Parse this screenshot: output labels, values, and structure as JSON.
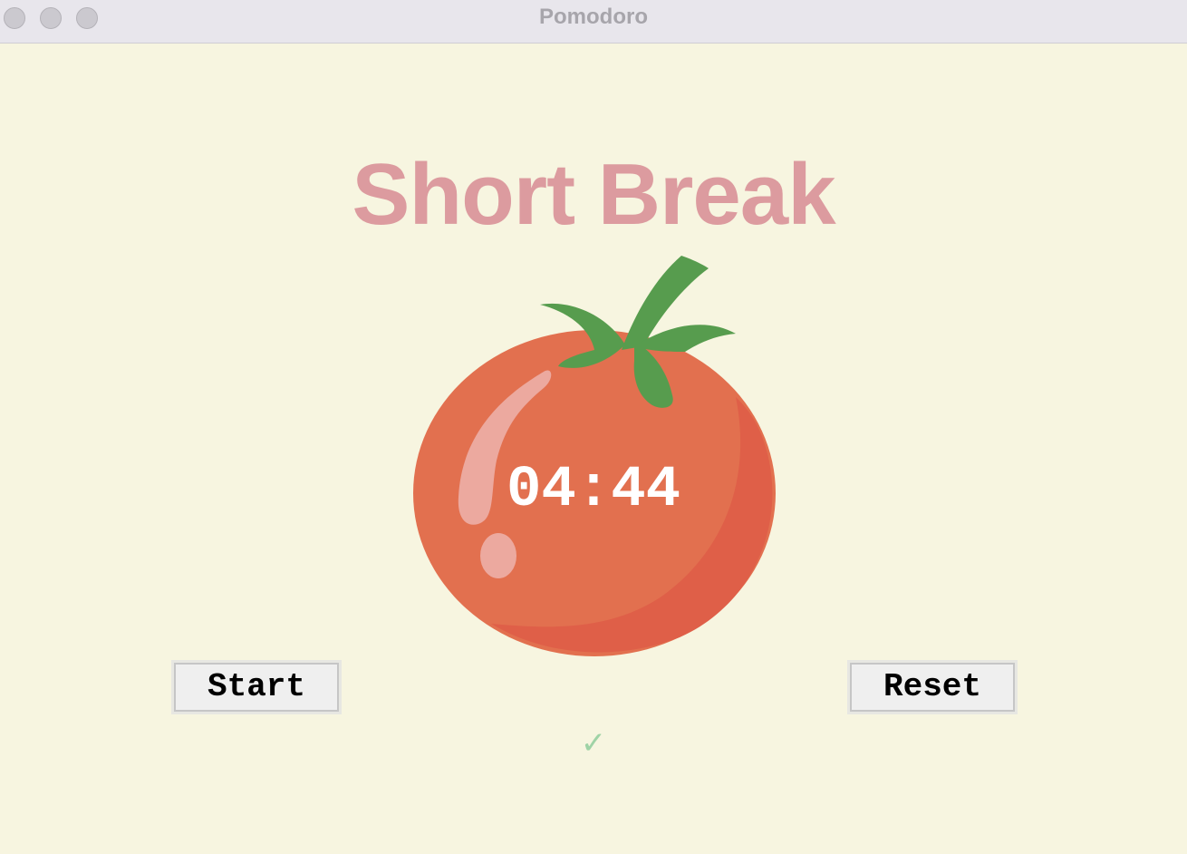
{
  "window": {
    "title": "Pomodoro"
  },
  "main": {
    "heading": "Short Break",
    "timer": "04:44",
    "checkmarks": "✓"
  },
  "controls": {
    "start_label": "Start",
    "reset_label": "Reset"
  },
  "icons": {
    "tomato": "tomato-icon",
    "traffic_lights": [
      "close-button",
      "minimize-button",
      "zoom-button"
    ]
  },
  "colors": {
    "background": "#f7f5e0",
    "heading": "#dc9b9f",
    "tomato_body": "#e2704f",
    "tomato_leaves": "#579c4e",
    "timer_text": "#ffffff",
    "checkmark": "#9fd3a6"
  }
}
